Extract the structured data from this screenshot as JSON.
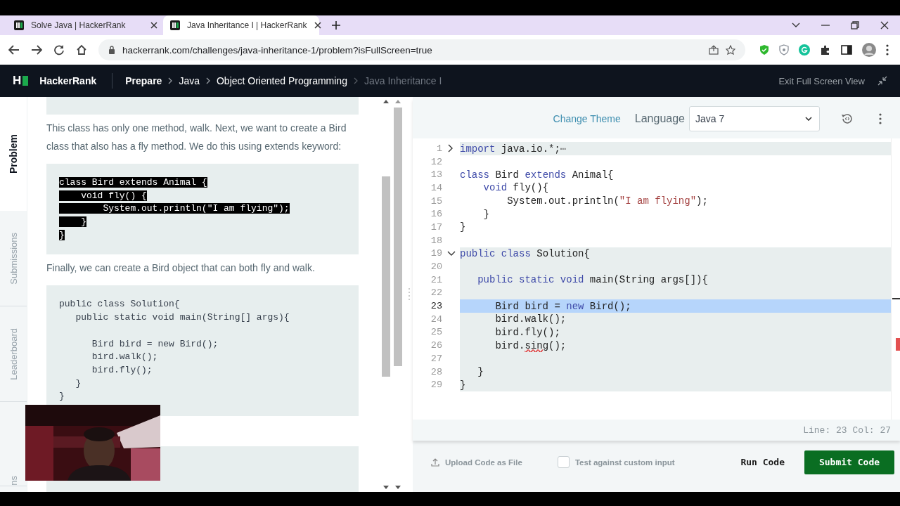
{
  "browser": {
    "tabs": [
      {
        "title": "Solve Java | HackerRank",
        "selected": false
      },
      {
        "title": "Java Inheritance I | HackerRank",
        "selected": true
      }
    ],
    "url": "hackerrank.com/challenges/java-inheritance-1/problem?isFullScreen=true"
  },
  "header": {
    "logo": "H",
    "brand": "HackerRank",
    "breadcrumbs": [
      {
        "label": "Prepare",
        "kind": "root"
      },
      {
        "label": "Java",
        "kind": "link"
      },
      {
        "label": "Object Oriented Programming",
        "kind": "link"
      },
      {
        "label": "Java Inheritance I",
        "kind": "current"
      }
    ],
    "exit": "Exit Full Screen View"
  },
  "side_tabs": [
    {
      "label": "Problem",
      "selected": true
    },
    {
      "label": "Submissions",
      "selected": false
    },
    {
      "label": "Leaderboard",
      "selected": false
    },
    {
      "label": "ns",
      "selected": false
    }
  ],
  "problem": [
    {
      "kind": "code_stub"
    },
    {
      "kind": "paragraph",
      "text": "This class has only one method, walk. Next, we want to create a Bird class that also has a fly method. We do this using extends keyword:"
    },
    {
      "kind": "code",
      "selected": true,
      "groups": [
        [
          "class Bird extends Animal {",
          "    void fly() {",
          "        System.out.println(\"I am flying\");",
          "    }",
          "}"
        ]
      ]
    },
    {
      "kind": "paragraph",
      "text": "Finally, we can create a Bird object that can both fly and walk."
    },
    {
      "kind": "code",
      "selected": false,
      "groups": [
        [
          "public class Solution{",
          "   public static void main(String[] args){"
        ],
        [
          "      Bird bird = new Bird();",
          "      bird.walk();",
          "      bird.fly();",
          "   }",
          "}"
        ]
      ]
    },
    {
      "kind": "output_stub"
    }
  ],
  "editor": {
    "change_theme": "Change Theme",
    "language_label": "Language",
    "language": "Java 7",
    "lines": [
      {
        "number": "1",
        "foldable": true,
        "expanded": false,
        "shaded": true,
        "tokens": [
          {
            "kind": "kw",
            "text": "import"
          },
          {
            "kind": "plain",
            "text": " java.io.*;"
          },
          {
            "kind": "fold",
            "text": "⋯"
          }
        ]
      },
      {
        "number": "12"
      },
      {
        "number": "13",
        "tokens": [
          {
            "kind": "kw",
            "text": "class"
          },
          {
            "kind": "plain",
            "text": " Bird "
          },
          {
            "kind": "kw",
            "text": "extends"
          },
          {
            "kind": "plain",
            "text": " Animal{"
          }
        ]
      },
      {
        "number": "14",
        "tokens": [
          {
            "kind": "kw",
            "text": "    void"
          },
          {
            "kind": "plain",
            "text": " fly(){"
          }
        ]
      },
      {
        "number": "15",
        "tokens": [
          {
            "kind": "plain",
            "text": "        System.out.println("
          },
          {
            "kind": "str",
            "text": "\"I am flying\""
          },
          {
            "kind": "plain",
            "text": ");"
          }
        ]
      },
      {
        "number": "16",
        "tokens": [
          {
            "kind": "plain",
            "text": "    }"
          }
        ]
      },
      {
        "number": "17",
        "tokens": [
          {
            "kind": "plain",
            "text": "}"
          }
        ]
      },
      {
        "number": "18"
      },
      {
        "number": "19",
        "foldable": true,
        "expanded": true,
        "shaded": true,
        "tokens": [
          {
            "kind": "kw",
            "text": "public class"
          },
          {
            "kind": "plain",
            "text": " Solution{"
          }
        ]
      },
      {
        "number": "20",
        "shaded": true
      },
      {
        "number": "21",
        "shaded": true,
        "tokens": [
          {
            "kind": "kw",
            "text": "   public static void"
          },
          {
            "kind": "plain",
            "text": " main(String args[]){"
          }
        ]
      },
      {
        "number": "22",
        "shaded": true
      },
      {
        "number": "23",
        "shaded": true,
        "current": true,
        "tokens": [
          {
            "kind": "plain",
            "text": "      Bird bird = "
          },
          {
            "kind": "kw",
            "text": "new"
          },
          {
            "kind": "plain",
            "text": " Bird();"
          }
        ]
      },
      {
        "number": "24",
        "shaded": true,
        "tokens": [
          {
            "kind": "plain",
            "text": "      bird.walk();"
          }
        ]
      },
      {
        "number": "25",
        "shaded": true,
        "tokens": [
          {
            "kind": "plain",
            "text": "      bird.fly();"
          }
        ]
      },
      {
        "number": "26",
        "shaded": true,
        "tokens": [
          {
            "kind": "plain",
            "text": "      bird."
          },
          {
            "kind": "err",
            "text": "sing"
          },
          {
            "kind": "plain",
            "text": "();"
          }
        ]
      },
      {
        "number": "27",
        "shaded": true
      },
      {
        "number": "28",
        "shaded": true,
        "tokens": [
          {
            "kind": "plain",
            "text": "   }"
          }
        ]
      },
      {
        "number": "29",
        "shaded": true,
        "tokens": [
          {
            "kind": "plain",
            "text": "}"
          }
        ]
      }
    ],
    "status": "Line: 23 Col: 27"
  },
  "footer": {
    "upload": "Upload Code as File",
    "custom_input": {
      "label": "Test against custom input",
      "checked": false
    },
    "run": "Run Code",
    "submit": "Submit Code"
  }
}
